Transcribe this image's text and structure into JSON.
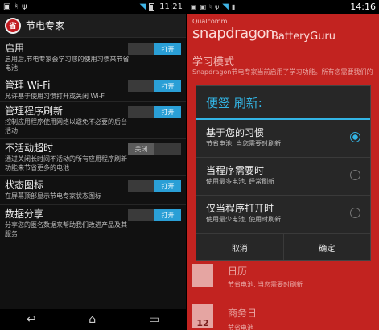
{
  "left": {
    "status_time": "11:21",
    "app_title": "节电专家",
    "app_icon_text": "省",
    "items": [
      {
        "title": "启用",
        "desc": "启用后,节电专家会学习您的使用习惯来节省电池",
        "toggle": "打开",
        "on": true
      },
      {
        "title": "管理 Wi-Fi",
        "desc": "允许基于使用习惯打开或关闭 Wi-Fi",
        "toggle": "打开",
        "on": true
      },
      {
        "title": "管理程序刷新",
        "desc": "控制应用程序使用网络以避免不必要的后台活动",
        "toggle": "打开",
        "on": true
      },
      {
        "title": "不活动超时",
        "desc": "通过关闭长时间不活动的所有应用程序刷新功能来节省更多的电池",
        "toggle": "关闭",
        "on": false
      },
      {
        "title": "状态图标",
        "desc": "在屏幕顶部显示节电专家状态图标",
        "toggle": "打开",
        "on": true
      },
      {
        "title": "数据分享",
        "desc": "分享您的匿名数据来帮助我们改进产品及其服务",
        "toggle": "打开",
        "on": true
      }
    ],
    "nav": {
      "back": "↩",
      "home": "⌂",
      "recent": "▭"
    }
  },
  "right": {
    "status_time": "14:16",
    "brand_small": "Qualcomm",
    "brand_big": "snapdragon",
    "brand_guru": "BatteryGuru",
    "bg_heading": "学习模式",
    "bg_text": "Snapdragon节电专家当前启用了学习功能。所有您需要我们的",
    "bg_item1_title": "日历",
    "bg_item1_desc": "节省电池, 当您需要时刷新",
    "bg_item2_title": "商务日",
    "bg_item2_desc": "节省电池",
    "bg_item2_num": "12",
    "dialog": {
      "title": "便签 刷新:",
      "options": [
        {
          "title": "基于您的习惯",
          "desc": "节省电池, 当您需要时刷新",
          "selected": true
        },
        {
          "title": "当程序需要时",
          "desc": "使用最多电池, 经常刷新",
          "selected": false
        },
        {
          "title": "仅当程序打开时",
          "desc": "使用最少电池, 使用时刷新",
          "selected": false
        }
      ],
      "cancel": "取消",
      "confirm": "确定"
    }
  }
}
